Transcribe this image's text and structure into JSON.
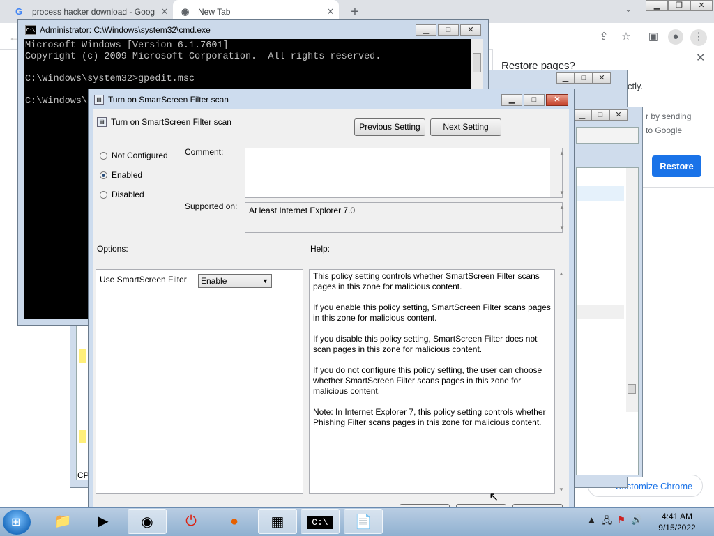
{
  "chrome": {
    "tabs": [
      {
        "label": "process hacker download - Goog",
        "icon": "google-icon"
      },
      {
        "label": "New Tab",
        "icon": "chrome-icon"
      }
    ],
    "new_tab_symbol": "+",
    "tab_close_symbol": "✕",
    "restore_popup": {
      "title": "Restore pages?",
      "text1": "ctly.",
      "text2_line1": "r by sending",
      "text2_line2": "to Google",
      "button": "Restore"
    },
    "customize_button": "Customize Chrome"
  },
  "cmd": {
    "title": "Administrator: C:\\Windows\\system32\\cmd.exe",
    "icon_text": "C:\\",
    "lines": "Microsoft Windows [Version 6.1.7601]\nCopyright (c) 2009 Microsoft Corporation.  All rights reserved.\n\nC:\\Windows\\system32>gpedit.msc\n\nC:\\Windows\\s"
  },
  "background_window": {
    "status_text": "CP"
  },
  "dialog": {
    "title": "Turn on SmartScreen Filter scan",
    "setting_name": "Turn on SmartScreen Filter scan",
    "previous_button": "Previous Setting",
    "next_button": "Next Setting",
    "radio_options": [
      {
        "label": "Not Configured",
        "checked": false
      },
      {
        "label": "Enabled",
        "checked": true
      },
      {
        "label": "Disabled",
        "checked": false
      }
    ],
    "comment_label": "Comment:",
    "comment_value": "",
    "supported_label": "Supported on:",
    "supported_value": "At least Internet Explorer 7.0",
    "options_label": "Options:",
    "help_label": "Help:",
    "option_name": "Use SmartScreen Filter",
    "option_value": "Enable",
    "help_paragraphs": [
      "This policy setting controls whether SmartScreen Filter scans pages in this zone for malicious content.",
      "If you enable this policy setting, SmartScreen Filter scans pages in this zone for malicious content.",
      "If you disable this policy setting, SmartScreen Filter does not scan pages in this zone for malicious content.",
      "If you do not configure this policy setting, the user can choose whether SmartScreen Filter scans pages in this zone for malicious content.",
      "Note: In Internet Explorer 7, this policy setting controls whether Phishing Filter scans pages in this zone for malicious content."
    ]
  },
  "taskbar": {
    "apps": [
      "explorer-icon",
      "media-player-icon",
      "chrome-icon",
      "power-icon",
      "firefox-icon",
      "monitor-icon",
      "cmd-icon",
      "notepad-icon"
    ],
    "clock_time": "4:41 AM",
    "clock_date": "9/15/2022"
  },
  "colors": {
    "accent_blue": "#1a73e8",
    "cmd_background": "#000000",
    "cmd_text": "#c0c0c0",
    "close_red": "#c4412a"
  }
}
